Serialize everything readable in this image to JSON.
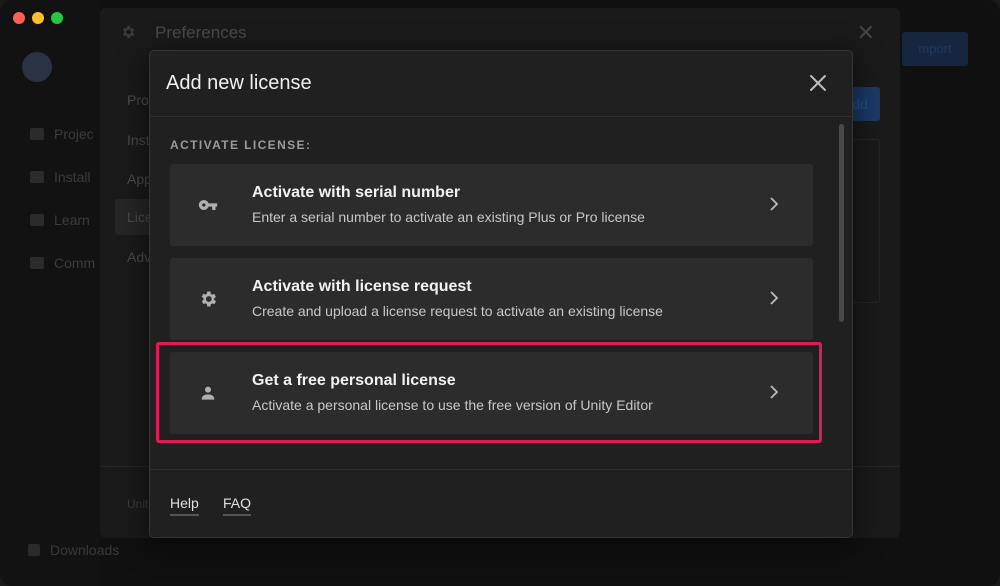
{
  "background": {
    "preferences_title": "Preferences",
    "menu_items": [
      "Pro",
      "Inst",
      "App",
      "Lice",
      "Adv"
    ],
    "add_button": "dd",
    "top_button": "mport",
    "sidebar_items": [
      "Projec",
      "Install",
      "Learn",
      "Comm"
    ],
    "downloads": "Downloads",
    "footer_text": "Unit"
  },
  "modal": {
    "title": "Add new license",
    "section_label": "ACTIVATE LICENSE:",
    "options": [
      {
        "title": "Activate with serial number",
        "description": "Enter a serial number to activate an existing Plus or Pro license",
        "icon": "key-icon"
      },
      {
        "title": "Activate with license request",
        "description": "Create and upload a license request to activate an existing license",
        "icon": "gear-icon"
      },
      {
        "title": "Get a free personal license",
        "description": "Activate a personal license to use the free version of Unity Editor",
        "icon": "person-icon"
      }
    ],
    "footer": {
      "help": "Help",
      "faq": "FAQ"
    }
  },
  "colors": {
    "highlight": "#e01a54",
    "modal_bg": "#202020",
    "option_bg": "#2c2c2c"
  }
}
